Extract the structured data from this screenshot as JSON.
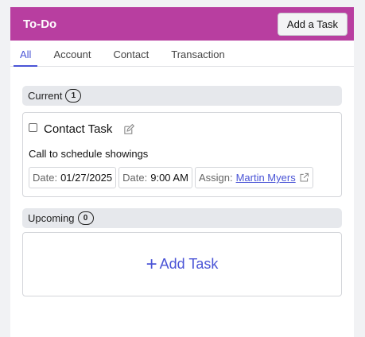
{
  "header": {
    "title": "To-Do",
    "add_button_label": "Add a Task",
    "accent_color": "#b83ea0"
  },
  "tabs": [
    {
      "label": "All",
      "active": true
    },
    {
      "label": "Account",
      "active": false
    },
    {
      "label": "Contact",
      "active": false
    },
    {
      "label": "Transaction",
      "active": false
    }
  ],
  "current": {
    "label": "Current",
    "count": "1",
    "tasks": [
      {
        "checked": false,
        "title": "Contact Task",
        "edit_icon": "pencil-square-icon",
        "description": "Call to schedule showings",
        "date_label": "Date:",
        "date_value": "01/27/2025",
        "time_label": "Date:",
        "time_value": "9:00 AM",
        "assign_label": "Assign:",
        "assignee": "Martin Myers",
        "assignee_icon": "external-link-icon"
      }
    ]
  },
  "upcoming": {
    "label": "Upcoming",
    "count": "0",
    "add_task_label": "Add Task",
    "add_icon": "plus-icon"
  }
}
